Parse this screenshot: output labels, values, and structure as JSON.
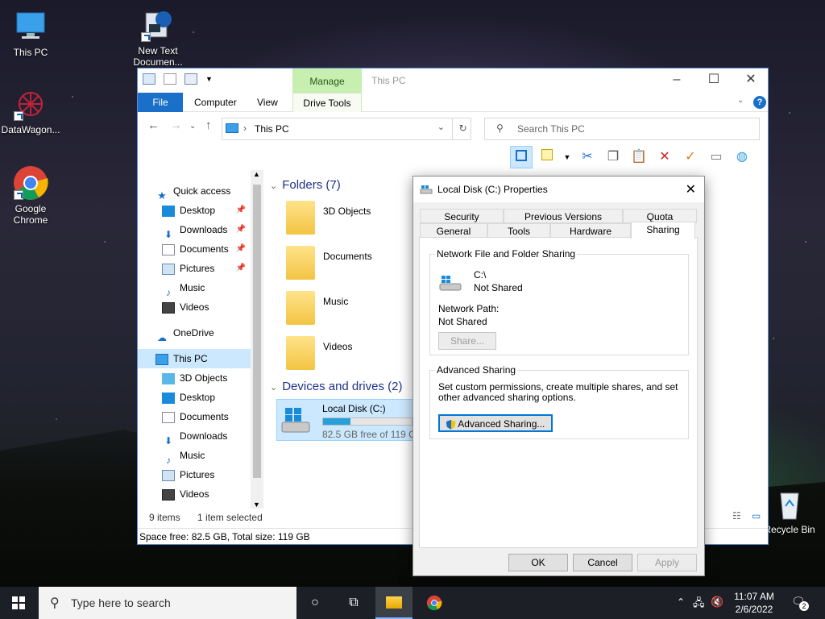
{
  "desktop": {
    "icons": [
      {
        "label": "This PC"
      },
      {
        "label": "New Text Documen..."
      },
      {
        "label": "DataWagon..."
      },
      {
        "label": "Google Chrome"
      },
      {
        "label": "Recycle Bin"
      }
    ]
  },
  "explorer": {
    "title": "This PC",
    "contextual_tab": "Manage",
    "tabs": [
      "File",
      "Computer",
      "View",
      "Drive Tools"
    ],
    "address": "This PC",
    "search_placeholder": "Search This PC",
    "nav": {
      "quick_access": "Quick access",
      "qa_items": [
        "Desktop",
        "Downloads",
        "Documents",
        "Pictures",
        "Music",
        "Videos"
      ],
      "onedrive": "OneDrive",
      "this_pc": "This PC",
      "pc_items": [
        "3D Objects",
        "Desktop",
        "Documents",
        "Downloads",
        "Music",
        "Pictures",
        "Videos"
      ]
    },
    "folders_header": "Folders (7)",
    "folders": [
      "3D Objects",
      "Documents",
      "Music",
      "Videos"
    ],
    "devices_header": "Devices and drives (2)",
    "drive": {
      "name": "Local Disk (C:)",
      "free": "82.5 GB free of 119 GB",
      "used_fraction": 0.31
    },
    "status_items": "9 items",
    "status_selected": "1 item selected",
    "status_space": "Space free: 82.5 GB, Total size: 119 GB"
  },
  "dialog": {
    "title": "Local Disk (C:) Properties",
    "tabs_row1": [
      "Security",
      "Previous Versions",
      "Quota"
    ],
    "tabs_row2": [
      "General",
      "Tools",
      "Hardware",
      "Sharing"
    ],
    "active_tab": "Sharing",
    "network_sharing_label": "Network File and Folder Sharing",
    "share_name": "C:\\",
    "share_state": "Not Shared",
    "network_path_label": "Network Path:",
    "network_path_value": "Not Shared",
    "share_button": "Share...",
    "advanced_label": "Advanced Sharing",
    "advanced_desc": "Set custom permissions, create multiple shares, and set other advanced sharing options.",
    "advanced_button": "Advanced Sharing...",
    "ok": "OK",
    "cancel": "Cancel",
    "apply": "Apply"
  },
  "taskbar": {
    "search_placeholder": "Type here to search",
    "time": "11:07 AM",
    "date": "2/6/2022",
    "notification_count": "2"
  }
}
